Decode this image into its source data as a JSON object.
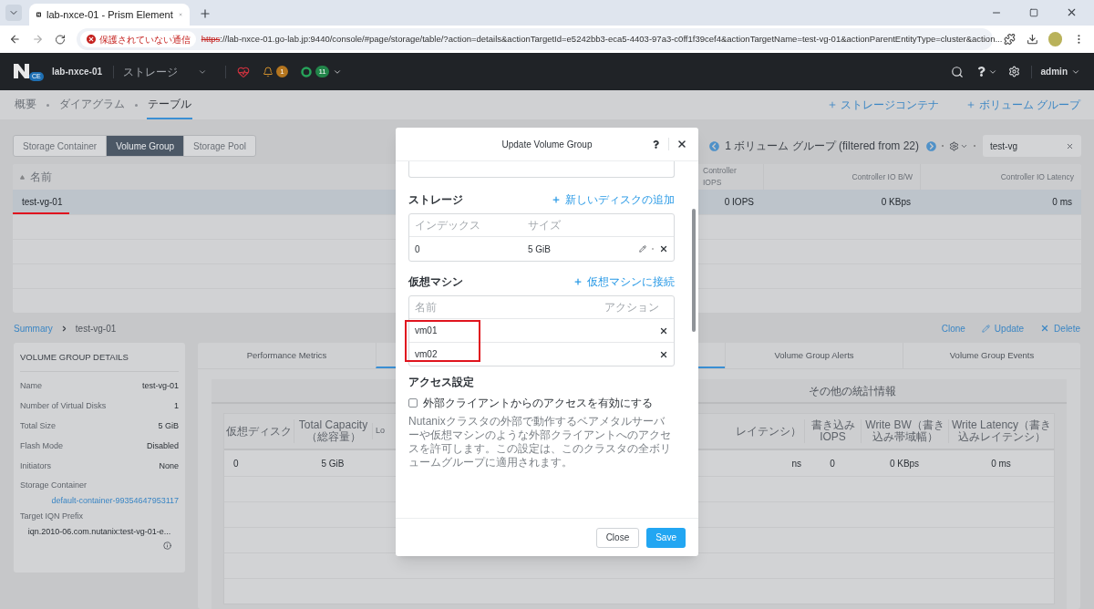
{
  "browser": {
    "tab_title": "lab-nxce-01 - Prism Element",
    "security_chip": "保護されていない通信",
    "url_scheme": "https",
    "url_rest": "://lab-nxce-01.go-lab.jp:9440/console/#page/storage/table/?action=details&actionTargetId=e5242bb3-eca5-4403-97a3-c0ff1f39cef4&actionTargetName=test-vg-01&actionParentEntityType=cluster&action..."
  },
  "header": {
    "logo_badge": "CE",
    "cluster": "lab-nxce-01",
    "section": "ストレージ",
    "alerts_count": "1",
    "tasks_count": "11",
    "user": "admin"
  },
  "subnav": {
    "tabs": [
      {
        "label": "概要",
        "selected": false
      },
      {
        "label": "ダイアグラム",
        "selected": false
      },
      {
        "label": "テーブル",
        "selected": true
      }
    ],
    "actions": [
      "ストレージコンテナ",
      "ボリューム グループ"
    ]
  },
  "view_toggle": [
    {
      "label": "Storage Container",
      "selected": false
    },
    {
      "label": "Volume Group",
      "selected": true
    },
    {
      "label": "Storage Pool",
      "selected": false
    }
  ],
  "pager": {
    "summary": "1 ボリューム グループ (filtered from 22)"
  },
  "search": {
    "value": "test-vg"
  },
  "table": {
    "columns": [
      "名前",
      "Controller IOPS",
      "Controller IO B/W",
      "Controller IO Latency"
    ],
    "rows": [
      {
        "cells": [
          "test-vg-01",
          "0 IOPS",
          "0 KBps",
          "0 ms"
        ],
        "selected": true
      }
    ]
  },
  "breadcrumb": {
    "root": "Summary",
    "current": "test-vg-01"
  },
  "entity_actions": [
    {
      "label": "Clone",
      "kind": "plain"
    },
    {
      "label": "Update",
      "kind": "edit"
    },
    {
      "label": "Delete",
      "kind": "delete"
    }
  ],
  "details": {
    "title": "VOLUME GROUP DETAILS",
    "fields": [
      {
        "label": "Name",
        "value": "test-vg-01",
        "kind": "inline"
      },
      {
        "label": "Number of Virtual Disks",
        "value": "1",
        "kind": "inline"
      },
      {
        "label": "Total Size",
        "value": "5 GiB",
        "kind": "inline"
      },
      {
        "label": "Flash Mode",
        "value": "Disabled",
        "kind": "inline"
      },
      {
        "label": "Initiators",
        "value": "None",
        "kind": "inline"
      },
      {
        "label": "Storage Container",
        "value": "default-container-99354647953117",
        "kind": "link"
      },
      {
        "label": "Target IQN Prefix",
        "value": "iqn.2010-06.com.nutanix:test-vg-01-e...",
        "kind": "info"
      }
    ]
  },
  "detail_tabs": [
    {
      "label": "Performance Metrics",
      "selected": false
    },
    {
      "selected": true
    },
    {
      "label": "Volume Group Alerts",
      "selected": false
    },
    {
      "label": "Volume Group Events",
      "selected": false
    }
  ],
  "stats": {
    "title": "その他の統計情報",
    "left_columns": [
      {
        "header": "仮想ディスク",
        "cell": "0"
      },
      {
        "header": "Total Capacity（総容量）",
        "cell": "5 GiB"
      }
    ],
    "cut_left": {
      "header": "Lo"
    },
    "cut_right": {
      "header": "レイテンシ）",
      "cell": "ns"
    },
    "right_columns": [
      {
        "header": "書き込み IOPS",
        "cell": "0"
      },
      {
        "header": "Write BW（書き込み帯域幅）",
        "cell": "0 KBps"
      },
      {
        "header": "Write Latency（書き込みレイテンシ）",
        "cell": "0 ms"
      }
    ]
  },
  "dialog": {
    "title": "Update Volume Group",
    "storage": {
      "heading": "ストレージ",
      "add_link": "新しいディスクの追加",
      "columns": [
        "インデックス",
        "サイズ"
      ],
      "disks": [
        {
          "index": "0",
          "size": "5 GiB"
        }
      ]
    },
    "vms": {
      "heading": "仮想マシン",
      "attach_link": "仮想マシンに接続",
      "columns": [
        "名前",
        "アクション"
      ],
      "items": [
        {
          "name": "vm01"
        },
        {
          "name": "vm02"
        }
      ]
    },
    "access": {
      "heading": "アクセス設定",
      "checkbox_label": "外部クライアントからのアクセスを有効にする",
      "checked": false,
      "description": "Nutanixクラスタの外部で動作するベアメタルサーバーや仮想マシンのような外部クライアントへのアクセスを許可します。この設定は、このクラスタの全ボリュームグループに適用されます。"
    },
    "buttons": [
      {
        "label": "Close",
        "kind": "secondary"
      },
      {
        "label": "Save",
        "kind": "primary"
      }
    ]
  }
}
